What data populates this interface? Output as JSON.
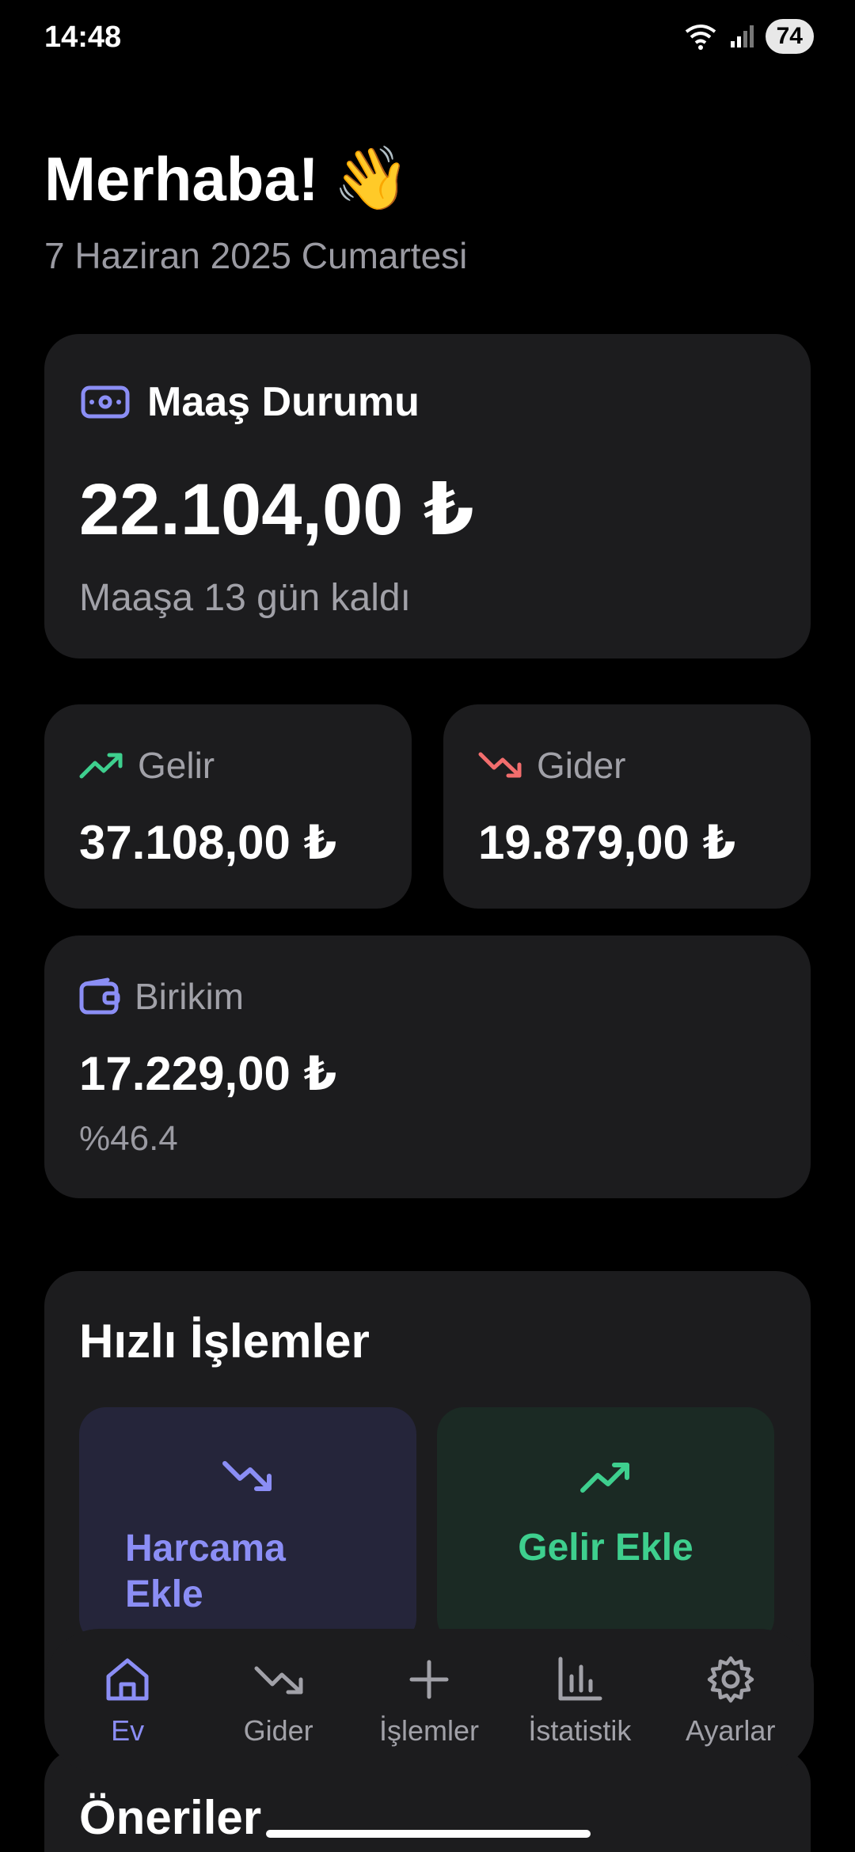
{
  "status_bar": {
    "time": "14:48",
    "battery": "74"
  },
  "header": {
    "greeting": "Merhaba!",
    "wave_emoji": "👋",
    "date": "7 Haziran 2025 Cumartesi"
  },
  "salary": {
    "title": "Maaş Durumu",
    "amount": "22.104,00 ₺",
    "subtitle": "Maaşa 13 gün kaldı",
    "icon": "cash-icon"
  },
  "income": {
    "label": "Gelir",
    "amount": "37.108,00 ₺",
    "icon": "trending-up-icon",
    "color": "#3ecf8e"
  },
  "expense": {
    "label": "Gider",
    "amount": "19.879,00 ₺",
    "icon": "trending-down-icon",
    "color": "#f26d6d"
  },
  "savings": {
    "label": "Birikim",
    "amount": "17.229,00 ₺",
    "percent": "%46.4",
    "icon": "wallet-icon"
  },
  "quick_actions": {
    "title": "Hızlı İşlemler",
    "add_expense": "Harcama Ekle",
    "add_income": "Gelir Ekle"
  },
  "tips": {
    "title": "Öneriler"
  },
  "nav": {
    "items": [
      {
        "label": "Ev",
        "icon": "home-icon",
        "active": true
      },
      {
        "label": "Gider",
        "icon": "trending-down-icon",
        "active": false
      },
      {
        "label": "İşlemler",
        "icon": "plus-icon",
        "active": false
      },
      {
        "label": "İstatistik",
        "icon": "bar-chart-icon",
        "active": false
      },
      {
        "label": "Ayarlar",
        "icon": "gear-icon",
        "active": false
      }
    ]
  },
  "colors": {
    "accent": "#8b8ef5",
    "income": "#3ecf8e",
    "expense": "#f26d6d",
    "card": "#1c1c1e"
  }
}
